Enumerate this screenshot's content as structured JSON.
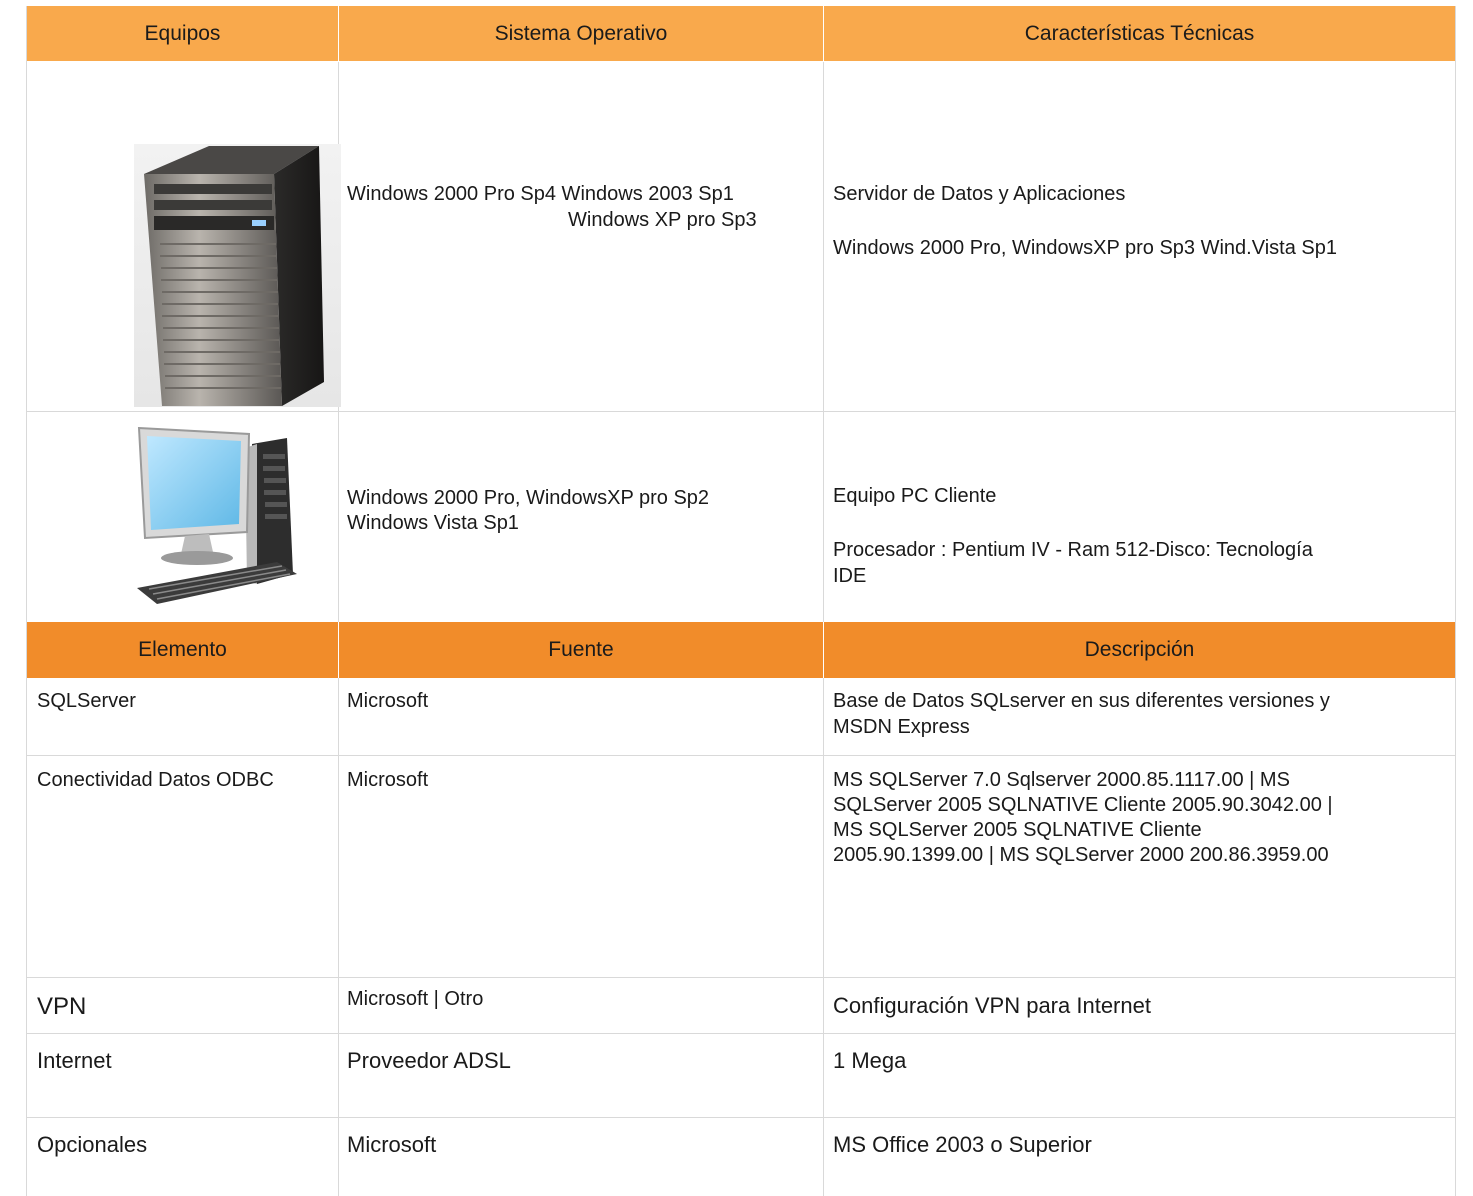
{
  "equipment_table": {
    "headers": [
      "Equipos",
      "Sistema Operativo",
      "Características Técnicas"
    ],
    "rows": [
      {
        "image": "server-tower-image",
        "os_line1": "Windows 2000 Pro Sp4 Windows 2003 Sp1",
        "os_line2": "Windows XP pro Sp3",
        "tech_line1": "Servidor de Datos y Aplicaciones",
        "tech_line2": "Windows 2000 Pro, WindowsXP pro Sp3 Wind.Vista Sp1"
      },
      {
        "image": "desktop-pc-image",
        "os_line1": "Windows 2000 Pro, WindowsXP pro Sp2",
        "os_line2": "Windows Vista Sp1",
        "tech_line1": "Equipo PC Cliente",
        "tech_line2a": "Procesador : Pentium IV - Ram 512-Disco: Tecnología",
        "tech_line2b": "IDE"
      }
    ]
  },
  "software_table": {
    "headers": [
      "Elemento",
      "Fuente",
      "Descripción"
    ],
    "rows": [
      {
        "element": "SQLServer",
        "source": "Microsoft",
        "desc": [
          "Base de Datos SQLserver en sus diferentes versiones y",
          "MSDN Express"
        ]
      },
      {
        "element": "Conectividad Datos ODBC",
        "source": "Microsoft",
        "desc": [
          "MS SQLServer 7.0 Sqlserver 2000.85.1117.00 | MS",
          "SQLServer 2005 SQLNATIVE Cliente 2005.90.3042.00 |",
          "MS SQLServer 2005 SQLNATIVE Cliente",
          "2005.90.1399.00 | MS SQLServer 2000 200.86.3959.00"
        ]
      },
      {
        "element": "VPN",
        "source": "Microsoft | Otro",
        "desc": [
          "Configuración VPN para Internet"
        ]
      },
      {
        "element": "Internet",
        "source": "Proveedor ADSL",
        "desc": [
          "1 Mega"
        ]
      },
      {
        "element": "Opcionales",
        "source": "Microsoft",
        "desc": [
          "MS Office 2003 o Superior"
        ]
      }
    ]
  },
  "colors": {
    "header_light": "#f9a94c",
    "header_dark": "#f18c2a",
    "grid": "#d9d9d9"
  }
}
